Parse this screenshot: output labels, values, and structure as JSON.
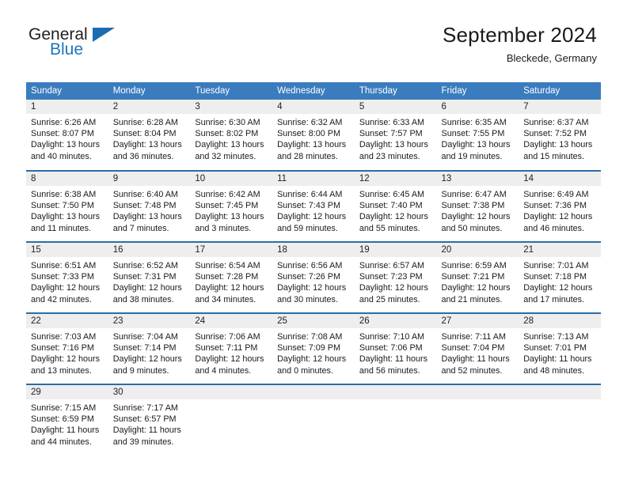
{
  "brand": {
    "name_part1": "General",
    "name_part2": "Blue",
    "accent_color": "#1b76bd",
    "triangle_color": "#1b6cb0"
  },
  "header": {
    "month_title": "September 2024",
    "location": "Bleckede, Germany"
  },
  "calendar": {
    "header_bg": "#3a7cbe",
    "daynum_bg": "#eeeeee",
    "divider_color": "#2b6ca9",
    "weekday_headers": [
      "Sunday",
      "Monday",
      "Tuesday",
      "Wednesday",
      "Thursday",
      "Friday",
      "Saturday"
    ],
    "weeks": [
      [
        {
          "day": "1",
          "sunrise": "Sunrise: 6:26 AM",
          "sunset": "Sunset: 8:07 PM",
          "daylight_line1": "Daylight: 13 hours",
          "daylight_line2": "and 40 minutes."
        },
        {
          "day": "2",
          "sunrise": "Sunrise: 6:28 AM",
          "sunset": "Sunset: 8:04 PM",
          "daylight_line1": "Daylight: 13 hours",
          "daylight_line2": "and 36 minutes."
        },
        {
          "day": "3",
          "sunrise": "Sunrise: 6:30 AM",
          "sunset": "Sunset: 8:02 PM",
          "daylight_line1": "Daylight: 13 hours",
          "daylight_line2": "and 32 minutes."
        },
        {
          "day": "4",
          "sunrise": "Sunrise: 6:32 AM",
          "sunset": "Sunset: 8:00 PM",
          "daylight_line1": "Daylight: 13 hours",
          "daylight_line2": "and 28 minutes."
        },
        {
          "day": "5",
          "sunrise": "Sunrise: 6:33 AM",
          "sunset": "Sunset: 7:57 PM",
          "daylight_line1": "Daylight: 13 hours",
          "daylight_line2": "and 23 minutes."
        },
        {
          "day": "6",
          "sunrise": "Sunrise: 6:35 AM",
          "sunset": "Sunset: 7:55 PM",
          "daylight_line1": "Daylight: 13 hours",
          "daylight_line2": "and 19 minutes."
        },
        {
          "day": "7",
          "sunrise": "Sunrise: 6:37 AM",
          "sunset": "Sunset: 7:52 PM",
          "daylight_line1": "Daylight: 13 hours",
          "daylight_line2": "and 15 minutes."
        }
      ],
      [
        {
          "day": "8",
          "sunrise": "Sunrise: 6:38 AM",
          "sunset": "Sunset: 7:50 PM",
          "daylight_line1": "Daylight: 13 hours",
          "daylight_line2": "and 11 minutes."
        },
        {
          "day": "9",
          "sunrise": "Sunrise: 6:40 AM",
          "sunset": "Sunset: 7:48 PM",
          "daylight_line1": "Daylight: 13 hours",
          "daylight_line2": "and 7 minutes."
        },
        {
          "day": "10",
          "sunrise": "Sunrise: 6:42 AM",
          "sunset": "Sunset: 7:45 PM",
          "daylight_line1": "Daylight: 13 hours",
          "daylight_line2": "and 3 minutes."
        },
        {
          "day": "11",
          "sunrise": "Sunrise: 6:44 AM",
          "sunset": "Sunset: 7:43 PM",
          "daylight_line1": "Daylight: 12 hours",
          "daylight_line2": "and 59 minutes."
        },
        {
          "day": "12",
          "sunrise": "Sunrise: 6:45 AM",
          "sunset": "Sunset: 7:40 PM",
          "daylight_line1": "Daylight: 12 hours",
          "daylight_line2": "and 55 minutes."
        },
        {
          "day": "13",
          "sunrise": "Sunrise: 6:47 AM",
          "sunset": "Sunset: 7:38 PM",
          "daylight_line1": "Daylight: 12 hours",
          "daylight_line2": "and 50 minutes."
        },
        {
          "day": "14",
          "sunrise": "Sunrise: 6:49 AM",
          "sunset": "Sunset: 7:36 PM",
          "daylight_line1": "Daylight: 12 hours",
          "daylight_line2": "and 46 minutes."
        }
      ],
      [
        {
          "day": "15",
          "sunrise": "Sunrise: 6:51 AM",
          "sunset": "Sunset: 7:33 PM",
          "daylight_line1": "Daylight: 12 hours",
          "daylight_line2": "and 42 minutes."
        },
        {
          "day": "16",
          "sunrise": "Sunrise: 6:52 AM",
          "sunset": "Sunset: 7:31 PM",
          "daylight_line1": "Daylight: 12 hours",
          "daylight_line2": "and 38 minutes."
        },
        {
          "day": "17",
          "sunrise": "Sunrise: 6:54 AM",
          "sunset": "Sunset: 7:28 PM",
          "daylight_line1": "Daylight: 12 hours",
          "daylight_line2": "and 34 minutes."
        },
        {
          "day": "18",
          "sunrise": "Sunrise: 6:56 AM",
          "sunset": "Sunset: 7:26 PM",
          "daylight_line1": "Daylight: 12 hours",
          "daylight_line2": "and 30 minutes."
        },
        {
          "day": "19",
          "sunrise": "Sunrise: 6:57 AM",
          "sunset": "Sunset: 7:23 PM",
          "daylight_line1": "Daylight: 12 hours",
          "daylight_line2": "and 25 minutes."
        },
        {
          "day": "20",
          "sunrise": "Sunrise: 6:59 AM",
          "sunset": "Sunset: 7:21 PM",
          "daylight_line1": "Daylight: 12 hours",
          "daylight_line2": "and 21 minutes."
        },
        {
          "day": "21",
          "sunrise": "Sunrise: 7:01 AM",
          "sunset": "Sunset: 7:18 PM",
          "daylight_line1": "Daylight: 12 hours",
          "daylight_line2": "and 17 minutes."
        }
      ],
      [
        {
          "day": "22",
          "sunrise": "Sunrise: 7:03 AM",
          "sunset": "Sunset: 7:16 PM",
          "daylight_line1": "Daylight: 12 hours",
          "daylight_line2": "and 13 minutes."
        },
        {
          "day": "23",
          "sunrise": "Sunrise: 7:04 AM",
          "sunset": "Sunset: 7:14 PM",
          "daylight_line1": "Daylight: 12 hours",
          "daylight_line2": "and 9 minutes."
        },
        {
          "day": "24",
          "sunrise": "Sunrise: 7:06 AM",
          "sunset": "Sunset: 7:11 PM",
          "daylight_line1": "Daylight: 12 hours",
          "daylight_line2": "and 4 minutes."
        },
        {
          "day": "25",
          "sunrise": "Sunrise: 7:08 AM",
          "sunset": "Sunset: 7:09 PM",
          "daylight_line1": "Daylight: 12 hours",
          "daylight_line2": "and 0 minutes."
        },
        {
          "day": "26",
          "sunrise": "Sunrise: 7:10 AM",
          "sunset": "Sunset: 7:06 PM",
          "daylight_line1": "Daylight: 11 hours",
          "daylight_line2": "and 56 minutes."
        },
        {
          "day": "27",
          "sunrise": "Sunrise: 7:11 AM",
          "sunset": "Sunset: 7:04 PM",
          "daylight_line1": "Daylight: 11 hours",
          "daylight_line2": "and 52 minutes."
        },
        {
          "day": "28",
          "sunrise": "Sunrise: 7:13 AM",
          "sunset": "Sunset: 7:01 PM",
          "daylight_line1": "Daylight: 11 hours",
          "daylight_line2": "and 48 minutes."
        }
      ],
      [
        {
          "day": "29",
          "sunrise": "Sunrise: 7:15 AM",
          "sunset": "Sunset: 6:59 PM",
          "daylight_line1": "Daylight: 11 hours",
          "daylight_line2": "and 44 minutes."
        },
        {
          "day": "30",
          "sunrise": "Sunrise: 7:17 AM",
          "sunset": "Sunset: 6:57 PM",
          "daylight_line1": "Daylight: 11 hours",
          "daylight_line2": "and 39 minutes."
        },
        {
          "day": "",
          "sunrise": "",
          "sunset": "",
          "daylight_line1": "",
          "daylight_line2": ""
        },
        {
          "day": "",
          "sunrise": "",
          "sunset": "",
          "daylight_line1": "",
          "daylight_line2": ""
        },
        {
          "day": "",
          "sunrise": "",
          "sunset": "",
          "daylight_line1": "",
          "daylight_line2": ""
        },
        {
          "day": "",
          "sunrise": "",
          "sunset": "",
          "daylight_line1": "",
          "daylight_line2": ""
        },
        {
          "day": "",
          "sunrise": "",
          "sunset": "",
          "daylight_line1": "",
          "daylight_line2": ""
        }
      ]
    ]
  }
}
